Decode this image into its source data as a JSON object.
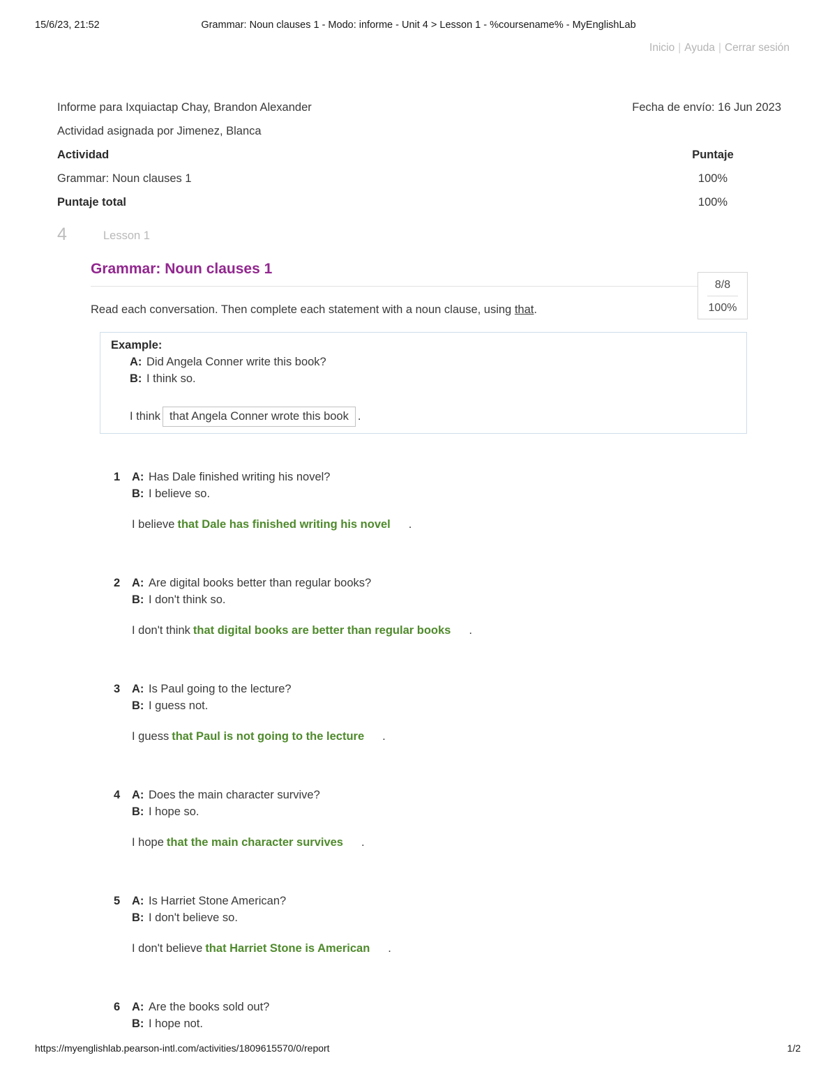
{
  "browser_print": {
    "date_time": "15/6/23, 21:52",
    "document_title": "Grammar: Noun clauses 1 - Modo: informe - Unit 4 > Lesson 1 - %coursename% - MyEnglishLab",
    "footer_url": "https://myenglishlab.pearson-intl.com/activities/1809615570/0/report",
    "page_number": "1/2"
  },
  "topnav": {
    "home": "Inicio",
    "help": "Ayuda",
    "logout": "Cerrar sesión",
    "separator": "|"
  },
  "report": {
    "student_line": "Informe para Ixquiactap Chay, Brandon Alexander",
    "submission_date": "Fecha de envío: 16 Jun 2023",
    "assigned_by": "Actividad asignada por Jimenez, Blanca",
    "col_activity": "Actividad",
    "col_score": "Puntaje",
    "activity_name": "Grammar: Noun clauses 1",
    "activity_score": "100%",
    "total_label": "Puntaje total",
    "total_score": "100%"
  },
  "unit": {
    "number": "4",
    "lesson": "Lesson 1"
  },
  "activity": {
    "title": "Grammar: Noun clauses 1",
    "instructions_before": "Read each conversation. Then complete each statement with a noun clause, using ",
    "instructions_keyword": "that",
    "instructions_after": ".",
    "score_fraction": "8/8",
    "score_percent": "100%"
  },
  "example": {
    "label": "Example:",
    "a_speaker": "A:",
    "a_text": "Did Angela Conner write this book?",
    "b_speaker": "B:",
    "b_text": "I think so.",
    "answer_prefix": "I think",
    "answer_value": "that Angela Conner wrote this book",
    "answer_suffix": "."
  },
  "questions": [
    {
      "number": "1",
      "a_speaker": "A:",
      "a_text": "Has Dale finished writing his novel?",
      "b_speaker": "B:",
      "b_text": "I believe so.",
      "answer_prefix": "I believe",
      "answer_value": "that Dale has finished writing his novel",
      "answer_suffix": "."
    },
    {
      "number": "2",
      "a_speaker": "A:",
      "a_text": "Are digital books better than regular books?",
      "b_speaker": "B:",
      "b_text": "I don't think so.",
      "answer_prefix": "I don't think",
      "answer_value": "that digital books are better than regular books",
      "answer_suffix": "."
    },
    {
      "number": "3",
      "a_speaker": "A:",
      "a_text": "Is Paul going to the lecture?",
      "b_speaker": "B:",
      "b_text": "I guess not.",
      "answer_prefix": "I guess",
      "answer_value": "that Paul is not going to the lecture",
      "answer_suffix": "."
    },
    {
      "number": "4",
      "a_speaker": "A:",
      "a_text": "Does the main character survive?",
      "b_speaker": "B:",
      "b_text": "I hope so.",
      "answer_prefix": "I hope",
      "answer_value": "that the main character survives",
      "answer_suffix": "."
    },
    {
      "number": "5",
      "a_speaker": "A:",
      "a_text": "Is Harriet Stone American?",
      "b_speaker": "B:",
      "b_text": "I don't believe so.",
      "answer_prefix": "I don't believe",
      "answer_value": "that Harriet Stone is American",
      "answer_suffix": "."
    },
    {
      "number": "6",
      "a_speaker": "A:",
      "a_text": "Are the books sold out?",
      "b_speaker": "B:",
      "b_text": "I hope not.",
      "answer_prefix": "",
      "answer_value": "",
      "answer_suffix": ""
    }
  ],
  "colors": {
    "activity_title_purple": "#92278F",
    "answer_green": "#4F8A2C",
    "example_border_blue": "#CDDDEA",
    "muted_gray": "#B9B9B9"
  }
}
